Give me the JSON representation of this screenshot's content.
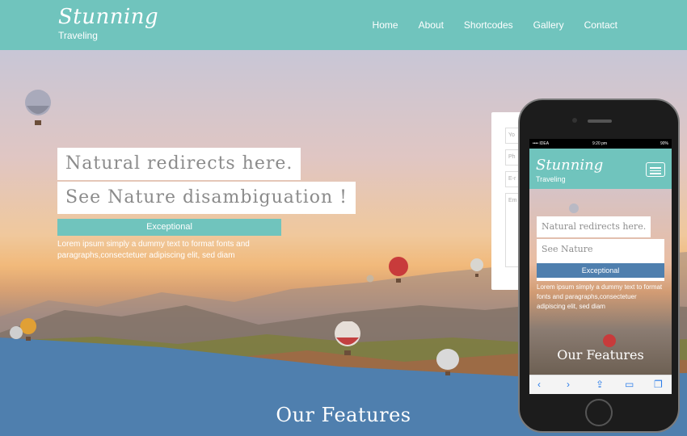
{
  "brand": {
    "title": "Stunning",
    "subtitle": "Traveling"
  },
  "nav": [
    "Home",
    "About",
    "Shortcodes",
    "Gallery",
    "Contact"
  ],
  "hero": {
    "headline_1": "Natural redirects here.",
    "headline_2": "See Nature disambiguation !",
    "cta": "Exceptional",
    "lead": "Lorem ipsum simply a dummy text to format fonts and paragraphs,consectetuer adipiscing elit, sed diam"
  },
  "form": {
    "placeholders": [
      "Yo",
      "Ph",
      "E-r",
      "Em"
    ]
  },
  "features": {
    "title": "Our Features"
  },
  "phone": {
    "status_left": "•••• IDEA",
    "status_time": "9:20 pm",
    "status_right": "90%",
    "brand_title": "Stunning",
    "brand_subtitle": "Traveling",
    "headline_1": "Natural redirects here.",
    "headline_2": "See Nature disambiguation !",
    "cta": "Exceptional",
    "lead": "Lorem ipsum simply a dummy text to format fonts and paragraphs,consectetuer adipiscing elit, sed diam",
    "features": "Our Features",
    "toolbar": {
      "back": "‹",
      "forward": "›",
      "share": "⇪",
      "bookmarks": "▭",
      "tabs": "❐"
    }
  },
  "colors": {
    "header": "#70c4bd",
    "section": "#4f7fae"
  }
}
